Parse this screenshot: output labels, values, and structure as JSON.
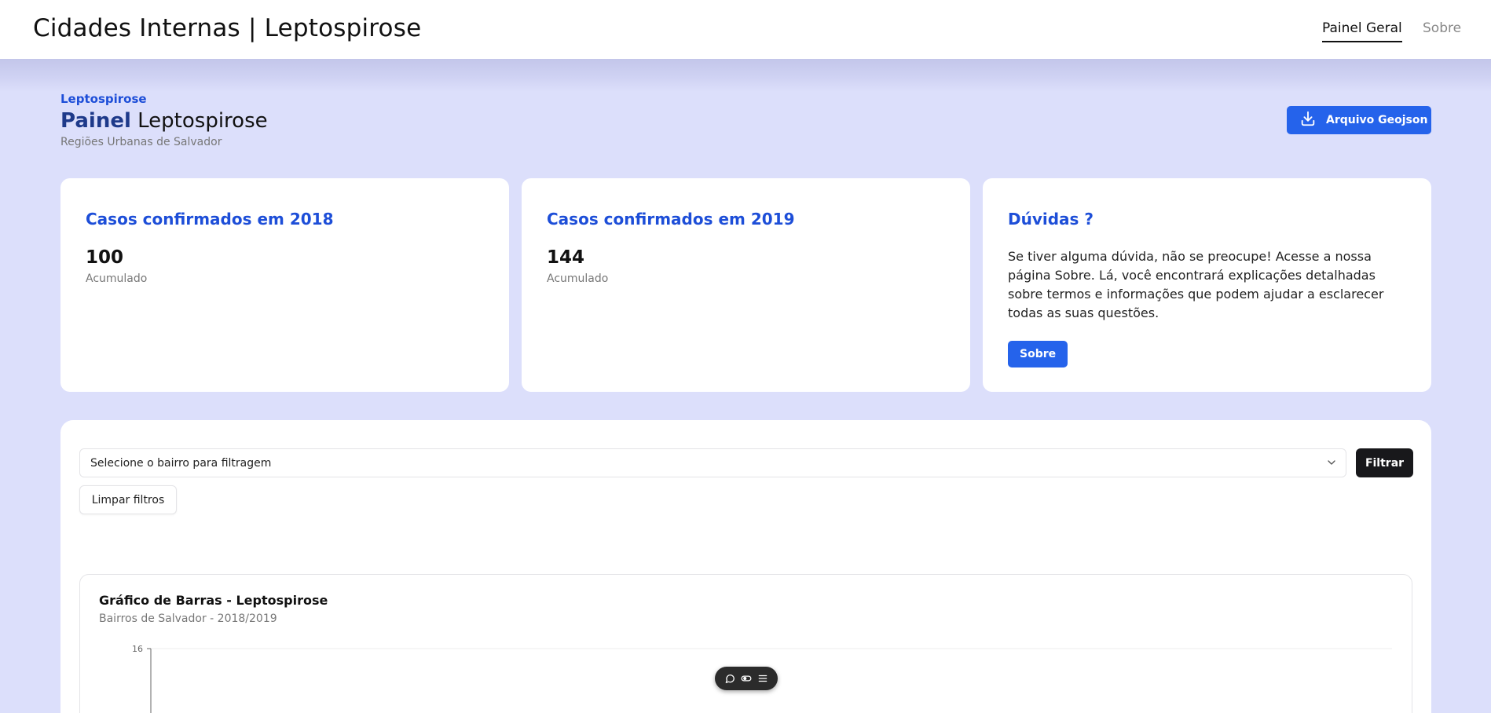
{
  "header": {
    "app_title": "Cidades Internas | Leptospirose",
    "nav": [
      {
        "label": "Painel Geral",
        "active": true
      },
      {
        "label": "Sobre",
        "active": false
      }
    ]
  },
  "page": {
    "eyebrow": "Leptospirose",
    "title_strong": "Painel",
    "title_rest": "Leptospirose",
    "subtitle": "Regiões Urbanas de Salvador",
    "download_label": "Arquivo Geojson"
  },
  "cards": [
    {
      "title": "Casos confirmados em 2018",
      "value": "100",
      "caption": "Acumulado"
    },
    {
      "title": "Casos confirmados em 2019",
      "value": "144",
      "caption": "Acumulado"
    }
  ],
  "help_card": {
    "title": "Dúvidas ?",
    "text": "Se tiver alguma dúvida, não se preocupe! Acesse a nossa página Sobre. Lá, você encontrará explicações detalhadas sobre termos e informações que podem ajudar a esclarecer todas as suas questões.",
    "button_label": "Sobre"
  },
  "filters": {
    "select_placeholder": "Selecione o bairro para filtragem",
    "filter_button": "Filtrar",
    "clear_button": "Limpar filtros"
  },
  "chart": {
    "title": "Gráfico de Barras - Leptospirose",
    "subtitle": "Bairros de Salvador - 2018/2019",
    "y_tick_top": "16"
  },
  "chart_data": {
    "type": "bar",
    "title": "Gráfico de Barras - Leptospirose",
    "subtitle": "Bairros de Salvador - 2018/2019",
    "y_ticks": [
      16
    ],
    "ylim": [
      0,
      16
    ],
    "grid": true
  },
  "floating_toolbar": {
    "icons": [
      "comment-icon",
      "toggle-icon",
      "menu-icon"
    ]
  },
  "colors": {
    "accent": "#2563eb",
    "title_blue": "#1d4ed8",
    "background": "#dcdffb"
  }
}
